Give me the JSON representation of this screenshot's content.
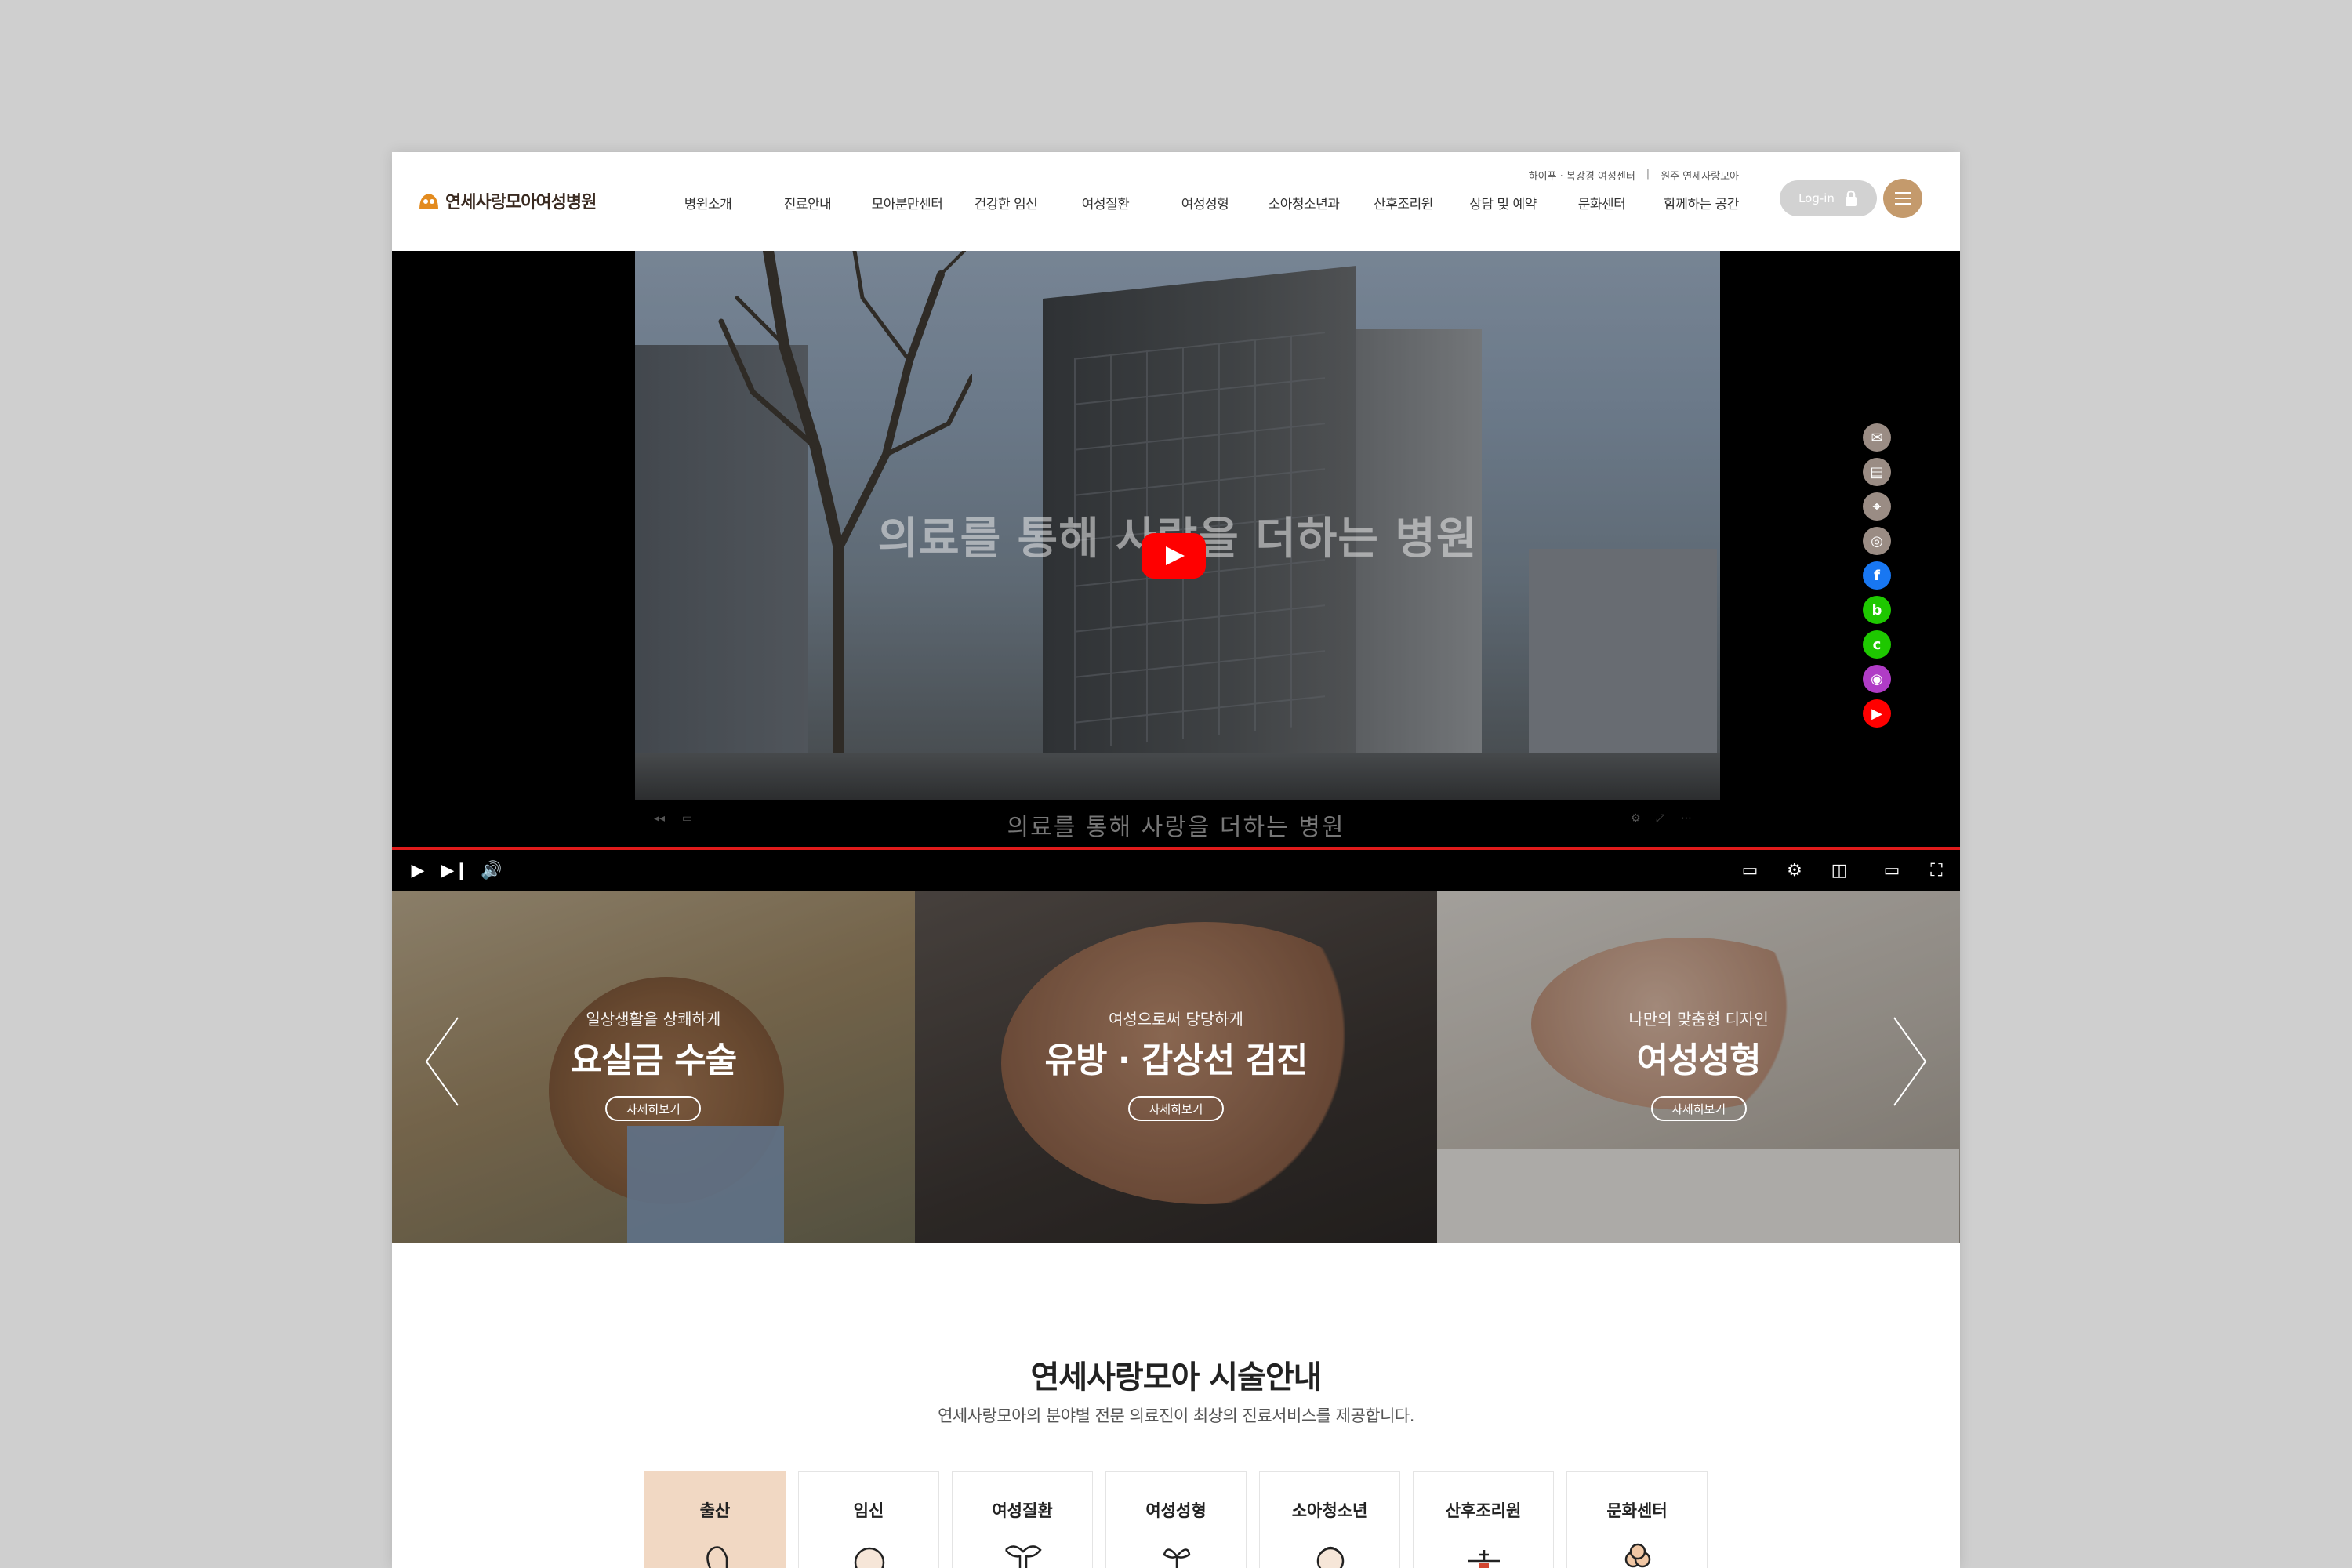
{
  "header": {
    "logo_text": "연세사랑모아여성병원",
    "util_links": [
      "하이푸 · 복강경 여성센터",
      "원주 연세사랑모아"
    ],
    "nav": [
      "병원소개",
      "진료안내",
      "모아분만센터",
      "건강한 임신",
      "여성질환",
      "여성성형",
      "소아청소년과",
      "산후조리원",
      "상담 및 예약",
      "문화센터",
      "함께하는 공간"
    ],
    "login_label": "Log-in"
  },
  "video": {
    "title": "의료를 통해 사랑을 더하는 병원",
    "caption": "의료를 통해 사랑을 더하는 병원"
  },
  "quick_links": [
    {
      "icon": "chat-icon",
      "color": "#9a8c84"
    },
    {
      "icon": "clipboard-icon",
      "color": "#9a8c84"
    },
    {
      "icon": "location-icon",
      "color": "#9a8c84"
    },
    {
      "icon": "camera-icon",
      "color": "#9a8c84"
    },
    {
      "icon": "facebook-icon",
      "color": "#1877f2"
    },
    {
      "icon": "blog-icon",
      "color": "#1ec800"
    },
    {
      "icon": "cafe-icon",
      "color": "#1ec800"
    },
    {
      "icon": "instagram-icon",
      "color": "#b03cc6"
    },
    {
      "icon": "youtube-icon",
      "color": "#ff0000"
    }
  ],
  "banners": [
    {
      "subtitle": "일상생활을 상쾌하게",
      "title": "요실금 수술",
      "more": "자세히보기"
    },
    {
      "subtitle": "여성으로써 당당하게",
      "title": "유방 · 갑상선 검진",
      "more": "자세히보기"
    },
    {
      "subtitle": "나만의 맞춤형 디자인",
      "title": "여성성형",
      "more": "자세히보기"
    }
  ],
  "section": {
    "title": "연세사랑모아 시술안내",
    "subtitle": "연세사랑모아의 분야별 전문 의료진이 최상의 진료서비스를 제공합니다."
  },
  "tabs": [
    {
      "label": "출산",
      "active": true
    },
    {
      "label": "임신",
      "active": false
    },
    {
      "label": "여성질환",
      "active": false
    },
    {
      "label": "여성성형",
      "active": false
    },
    {
      "label": "소아청소년",
      "active": false
    },
    {
      "label": "산후조리원",
      "active": false
    },
    {
      "label": "문화센터",
      "active": false
    }
  ],
  "colors": {
    "accent": "#c49a6c",
    "tab_active": "#f1d8c3",
    "progress": "#e01b1b"
  }
}
